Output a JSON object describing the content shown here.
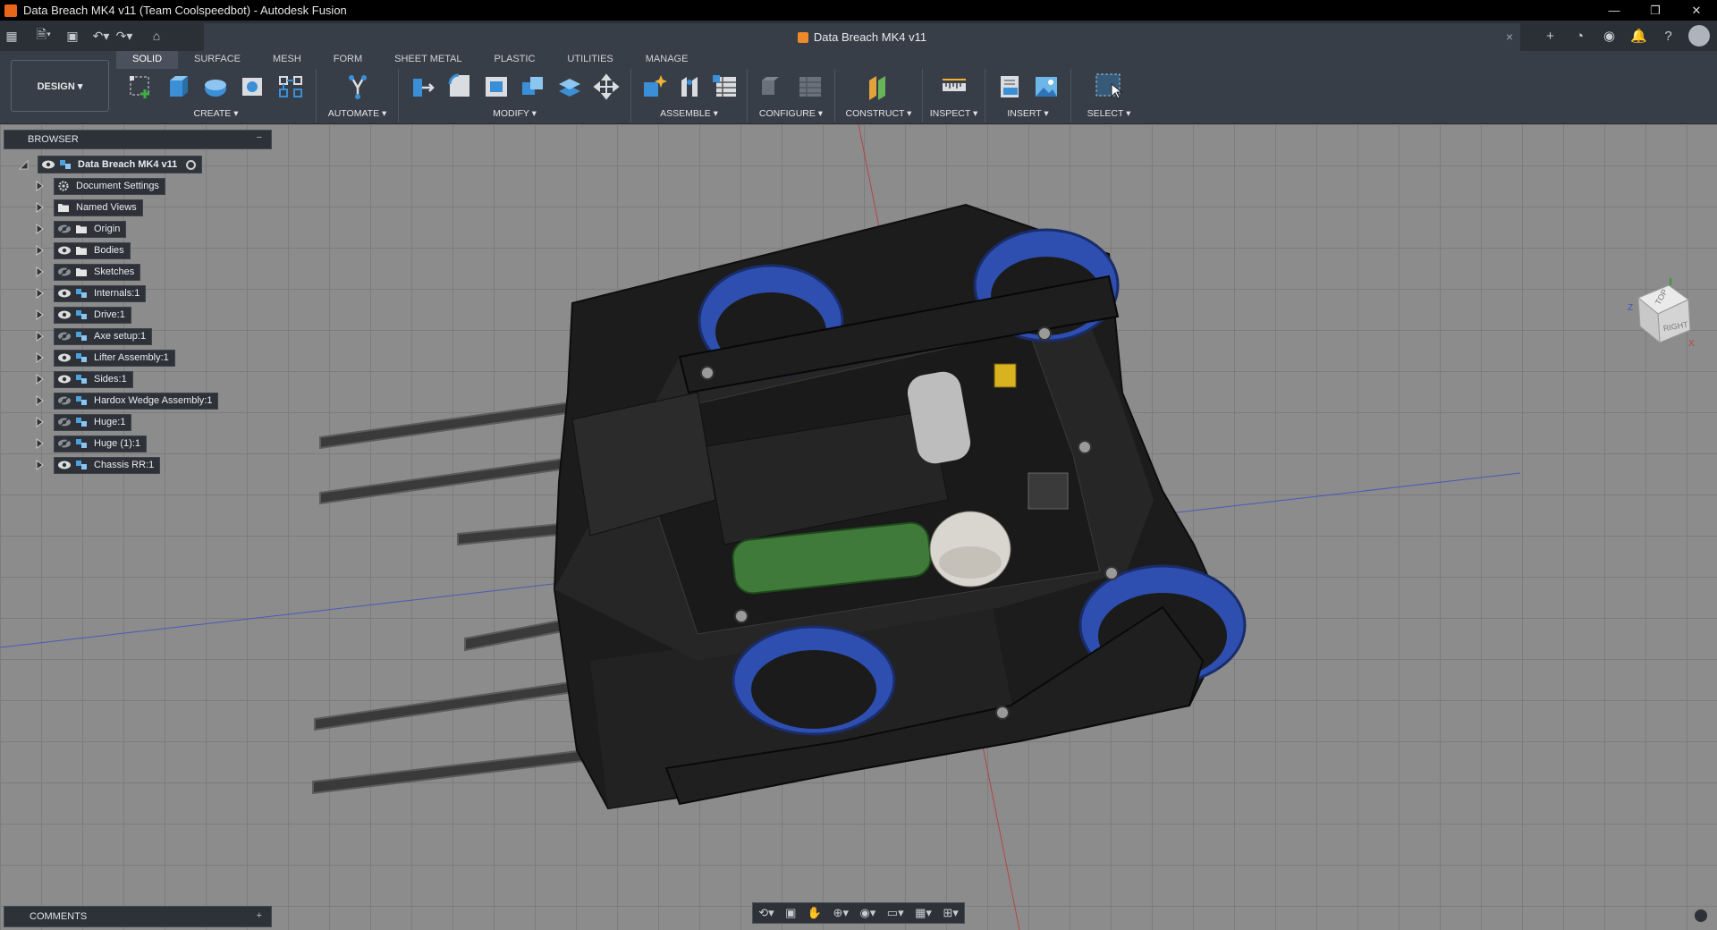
{
  "window": {
    "title": "Data Breach MK4 v11 (Team Coolspeedbot) - Autodesk Fusion",
    "controls": [
      "—",
      "❐",
      "✕"
    ]
  },
  "document_tab": {
    "title": "Data Breach MK4 v11",
    "close_glyph": "×"
  },
  "workspace": {
    "label": "DESIGN ▾"
  },
  "toolbar_tabs": [
    "SOLID",
    "SURFACE",
    "MESH",
    "FORM",
    "SHEET METAL",
    "PLASTIC",
    "UTILITIES",
    "MANAGE"
  ],
  "toolbar_groups": {
    "create": "CREATE ▾",
    "automate": "AUTOMATE ▾",
    "modify": "MODIFY ▾",
    "assemble": "ASSEMBLE ▾",
    "configure": "CONFIGURE ▾",
    "construct": "CONSTRUCT ▾",
    "inspect": "INSPECT ▾",
    "insert": "INSERT ▾",
    "select": "SELECT ▾"
  },
  "browser": {
    "header": "BROWSER",
    "root": "Data Breach MK4 v11",
    "items": [
      {
        "label": "Document Settings",
        "icon": "gear-icon"
      },
      {
        "label": "Named Views",
        "icon": "folder-icon"
      },
      {
        "label": "Origin",
        "icon": "folder-icon"
      },
      {
        "label": "Bodies",
        "icon": "folder-icon"
      },
      {
        "label": "Sketches",
        "icon": "folder-icon"
      },
      {
        "label": "Internals:1",
        "icon": "component-icon"
      },
      {
        "label": "Drive:1",
        "icon": "component-icon"
      },
      {
        "label": "Axe setup:1",
        "icon": "component-icon"
      },
      {
        "label": "Lifter Assembly:1",
        "icon": "component-icon"
      },
      {
        "label": "Sides:1",
        "icon": "component-icon"
      },
      {
        "label": "Hardox Wedge Assembly:1",
        "icon": "component-icon"
      },
      {
        "label": "Huge:1",
        "icon": "component-icon"
      },
      {
        "label": "Huge (1):1",
        "icon": "component-icon"
      },
      {
        "label": "Chassis RR:1",
        "icon": "component-icon"
      }
    ]
  },
  "comments": {
    "label": "COMMENTS",
    "add": "+"
  },
  "viewcube": {
    "top": "TOP",
    "right": "RIGHT",
    "z": "Z",
    "x": "X"
  },
  "colors": {
    "accent": "#0696d7",
    "wheel": "#2e4fb0",
    "battery": "#3f7a3a",
    "chassis": "#1c1c1c",
    "grid": "#8c8c8c"
  }
}
